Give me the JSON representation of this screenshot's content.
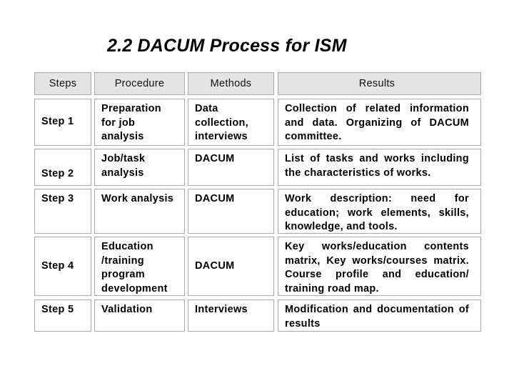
{
  "slide": {
    "title": "2.2  DACUM Process for ISM"
  },
  "table": {
    "headers": [
      "Steps",
      "Procedure",
      "Methods",
      "Results"
    ],
    "rows": [
      {
        "step": "Step 1",
        "procedure": "Preparation for job analysis",
        "methods": "Data collection, interviews",
        "results": "Collection of related information and data. Organizing of DACUM committee."
      },
      {
        "step": "Step 2",
        "procedure": "Job/task analysis",
        "methods": "DACUM",
        "results": "List of tasks and works including the characteristics of works."
      },
      {
        "step": "Step 3",
        "procedure": "Work analysis",
        "methods": "DACUM",
        "results": "Work description: need for education; work elements, skills, knowledge, and tools."
      },
      {
        "step": "Step 4",
        "procedure": "Education /training program development",
        "methods": "DACUM",
        "results": "Key works/education contents matrix, Key works/courses matrix. Course profile and education/ training road map."
      },
      {
        "step": "Step 5",
        "procedure": "Validation",
        "methods": "Interviews",
        "results": "Modification and documentation of results"
      }
    ]
  }
}
